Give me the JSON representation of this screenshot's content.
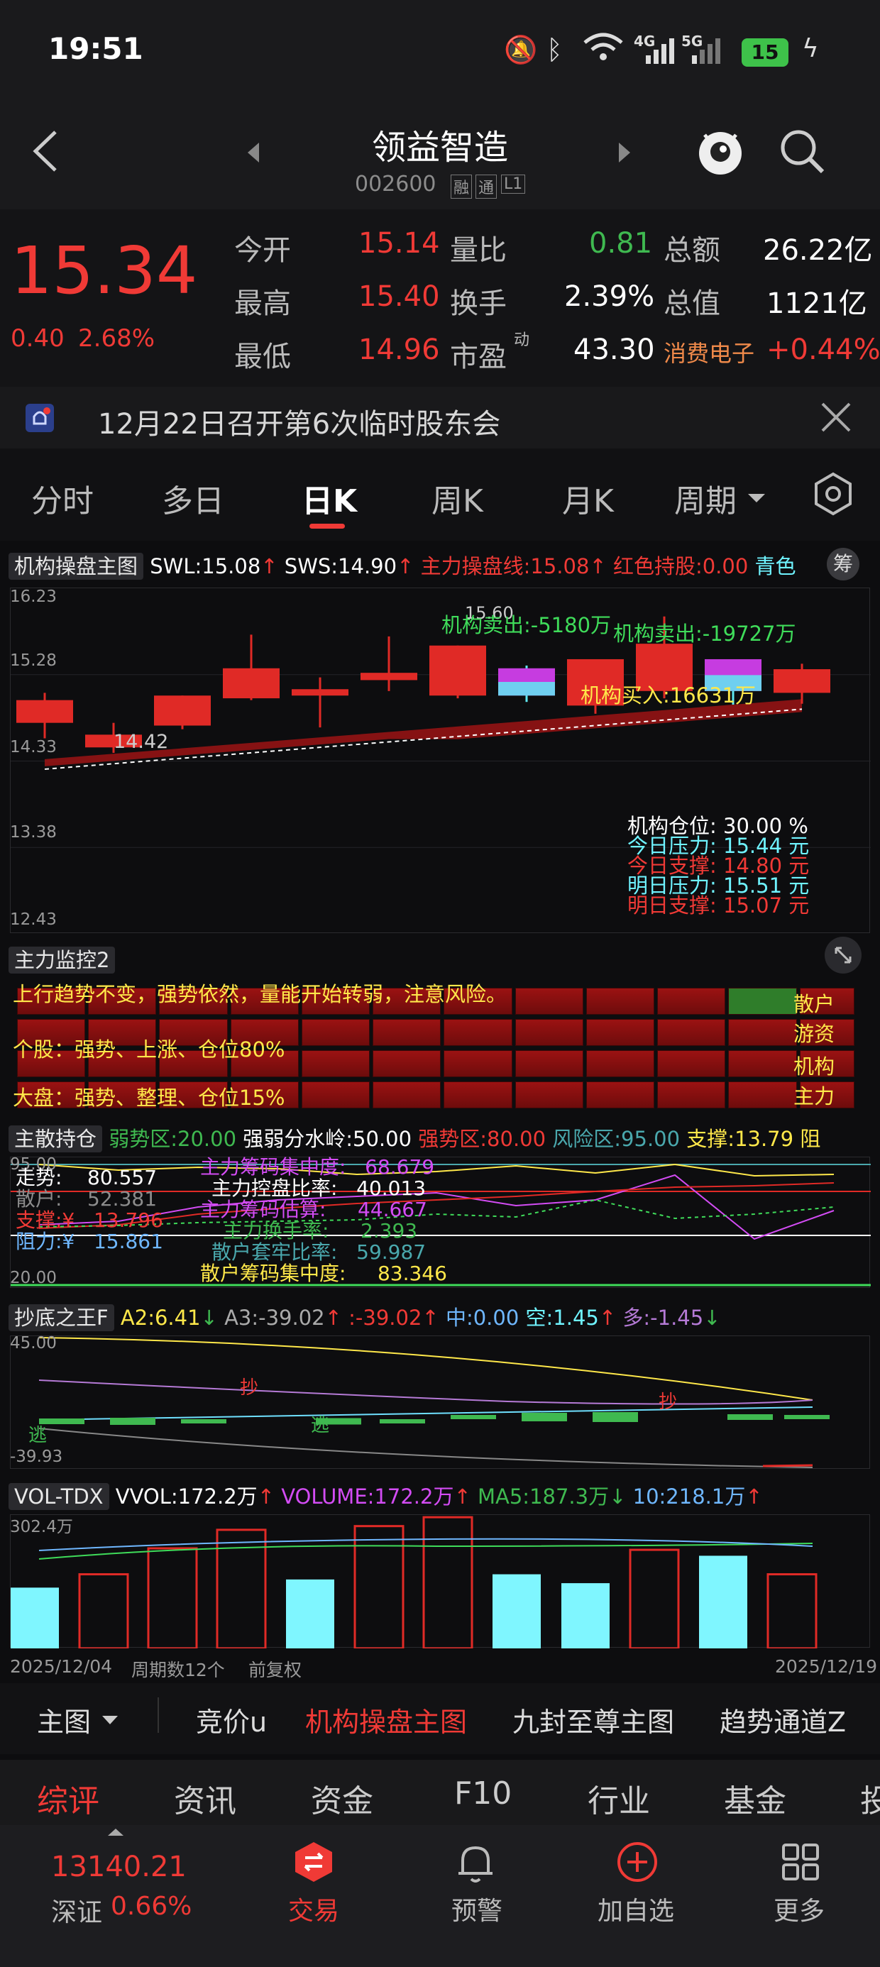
{
  "status": {
    "time": "19:51",
    "battery": "15",
    "net1": "4G",
    "net2": "5G"
  },
  "header": {
    "title": "领益智造",
    "code": "002600",
    "badges": [
      "融",
      "通",
      "L1"
    ]
  },
  "quote": {
    "price": "15.34",
    "change": "0.40",
    "change_pct": "2.68%",
    "labels": {
      "open": "今开",
      "high": "最高",
      "low": "最低",
      "ratio": "量比",
      "turnover": "换手",
      "pe": "市盈",
      "pe_sup": "动",
      "amount": "总额",
      "mcap": "总值",
      "sector": "消费电子"
    },
    "open": "15.14",
    "high": "15.40",
    "low": "14.96",
    "vol_ratio": "0.81",
    "turnover": "2.39%",
    "pe": "43.30",
    "amount": "26.22亿",
    "mcap": "1121亿",
    "sector_chg": "+0.44%"
  },
  "notice": {
    "text": "12月22日召开第6次临时股东会"
  },
  "tabs": [
    "分时",
    "多日",
    "日K",
    "周K",
    "月K",
    "周期"
  ],
  "main_chart": {
    "indicator": "机构操盘主图",
    "swl": "SWL:15.08",
    "sws": "SWS:14.90",
    "zl": "主力操盘线:15.08",
    "hold": "红色持股:0.00",
    "cyan": "青色",
    "chip": "筹",
    "yticks": [
      "16.23",
      "15.28",
      "14.33",
      "13.38",
      "12.43"
    ],
    "low_label": "14.42",
    "high_label": "15.60",
    "ann1": "机构卖出:-5180万",
    "ann2": "机构卖出:-19727万",
    "ann3": "机构买入:16631万",
    "info": [
      {
        "k": "机构仓位:",
        "v": "30.00 %"
      },
      {
        "k": "今日压力:",
        "v": "15.44 元"
      },
      {
        "k": "今日支撑:",
        "v": "14.80 元"
      },
      {
        "k": "明日压力:",
        "v": "15.51 元"
      },
      {
        "k": "明日支撑:",
        "v": "15.07 元"
      }
    ]
  },
  "chart_data": {
    "type": "candlestick",
    "x": [
      "2025/12/04",
      "",
      "",
      "",
      "",
      "",
      "",
      "",
      "",
      "",
      "",
      "2025/12/19"
    ],
    "candles": [
      {
        "o": 14.75,
        "c": 15.0,
        "h": 15.08,
        "l": 14.58,
        "color": "red"
      },
      {
        "o": 14.48,
        "c": 14.62,
        "h": 14.75,
        "l": 14.42,
        "color": "red"
      },
      {
        "o": 14.72,
        "c": 15.05,
        "h": 15.05,
        "l": 14.68,
        "color": "red"
      },
      {
        "o": 15.02,
        "c": 15.35,
        "h": 15.72,
        "l": 15.0,
        "color": "red"
      },
      {
        "o": 15.05,
        "c": 15.12,
        "h": 15.25,
        "l": 14.7,
        "color": "red"
      },
      {
        "o": 15.22,
        "c": 15.3,
        "h": 15.7,
        "l": 15.1,
        "color": "red"
      },
      {
        "o": 15.05,
        "c": 15.6,
        "h": 15.6,
        "l": 15.02,
        "color": "red"
      },
      {
        "o": 15.05,
        "c": 15.35,
        "h": 15.38,
        "l": 14.98,
        "color": "magenta"
      },
      {
        "o": 14.94,
        "c": 15.45,
        "h": 15.45,
        "l": 14.85,
        "color": "red"
      },
      {
        "o": 15.1,
        "c": 15.62,
        "h": 15.92,
        "l": 15.02,
        "color": "red"
      },
      {
        "o": 15.1,
        "c": 15.45,
        "h": 15.45,
        "l": 14.95,
        "color": "magenta"
      },
      {
        "o": 15.08,
        "c": 15.34,
        "h": 15.4,
        "l": 14.96,
        "color": "red"
      }
    ],
    "ylim": [
      12.43,
      16.23
    ],
    "volume": {
      "values": [
        82,
        100,
        135,
        160,
        93,
        165,
        177,
        100,
        88,
        133,
        125,
        100
      ],
      "colors": [
        "cyan",
        "red",
        "red",
        "red",
        "cyan",
        "red",
        "red",
        "cyan",
        "cyan",
        "red",
        "cyan",
        "red"
      ],
      "max_label": "302.4万"
    }
  },
  "monitor": {
    "label": "主力监控2",
    "line": "上行趋势不变，强势依然，量能开始转弱，注意风险。",
    "stock": "个股：强势、上涨、仓位80%",
    "market": "大盘：强势、整理、仓位15%",
    "legend": [
      "散户",
      "游资",
      "机构",
      "主力"
    ]
  },
  "chips": {
    "label": "主散持仓",
    "weak": "弱势区:20.00",
    "mid": "强弱分水岭:50.00",
    "strong": "强势区:80.00",
    "risk": "风险区:95.00",
    "support": "支撑:13.79",
    "resist": "阻",
    "top": "95.00",
    "bottom": "20.00",
    "rows": [
      {
        "k": "走势:",
        "v": "80.557"
      },
      {
        "k": "散户:",
        "v": "52.381"
      },
      {
        "k": "支撑:¥",
        "v": "13.796"
      },
      {
        "k": "阻力:¥",
        "v": "15.861"
      }
    ],
    "rows2": [
      {
        "k": "主力筹码集中度:",
        "v": "68.679"
      },
      {
        "k": "主力控盘比率:",
        "v": "40.013"
      },
      {
        "k": "主力筹码估算:",
        "v": "44.667"
      },
      {
        "k": "主力换手率:",
        "v": "2.393"
      },
      {
        "k": "散户套牢比率:",
        "v": "59.987"
      },
      {
        "k": "散户筹码集中度:",
        "v": "83.346"
      }
    ]
  },
  "bottom_ind": {
    "label": "抄底之王F",
    "a2": "A2:6.41",
    "a3": "A3:-39.02",
    "c": ":-39.02",
    "z": "中:0.00",
    "k": "空:1.45",
    "d": "多:-1.45",
    "top": "45.00",
    "bottom": "-39.93",
    "chao": "抄",
    "tao": "逃"
  },
  "vol": {
    "label": "VOL-TDX",
    "vvol": "VVOL:172.2万",
    "volume": "VOLUME:172.2万",
    "ma5": "MA5:187.3万",
    "ma10": "10:218.1万",
    "start": "2025/12/04",
    "count": "周期数12个",
    "adj": "前复权",
    "end": "2025/12/19"
  },
  "chart_tabs": [
    "主图",
    "竞价u",
    "机构操盘主图",
    "九封至尊主图",
    "趋势通道Z"
  ],
  "sections": [
    "综评",
    "资讯",
    "资金",
    "F10",
    "行业",
    "基金",
    "投"
  ],
  "dock": {
    "index": "13140.21",
    "index_name": "深证",
    "index_pct": "0.66%",
    "items": [
      "交易",
      "预警",
      "加自选",
      "更多"
    ]
  }
}
